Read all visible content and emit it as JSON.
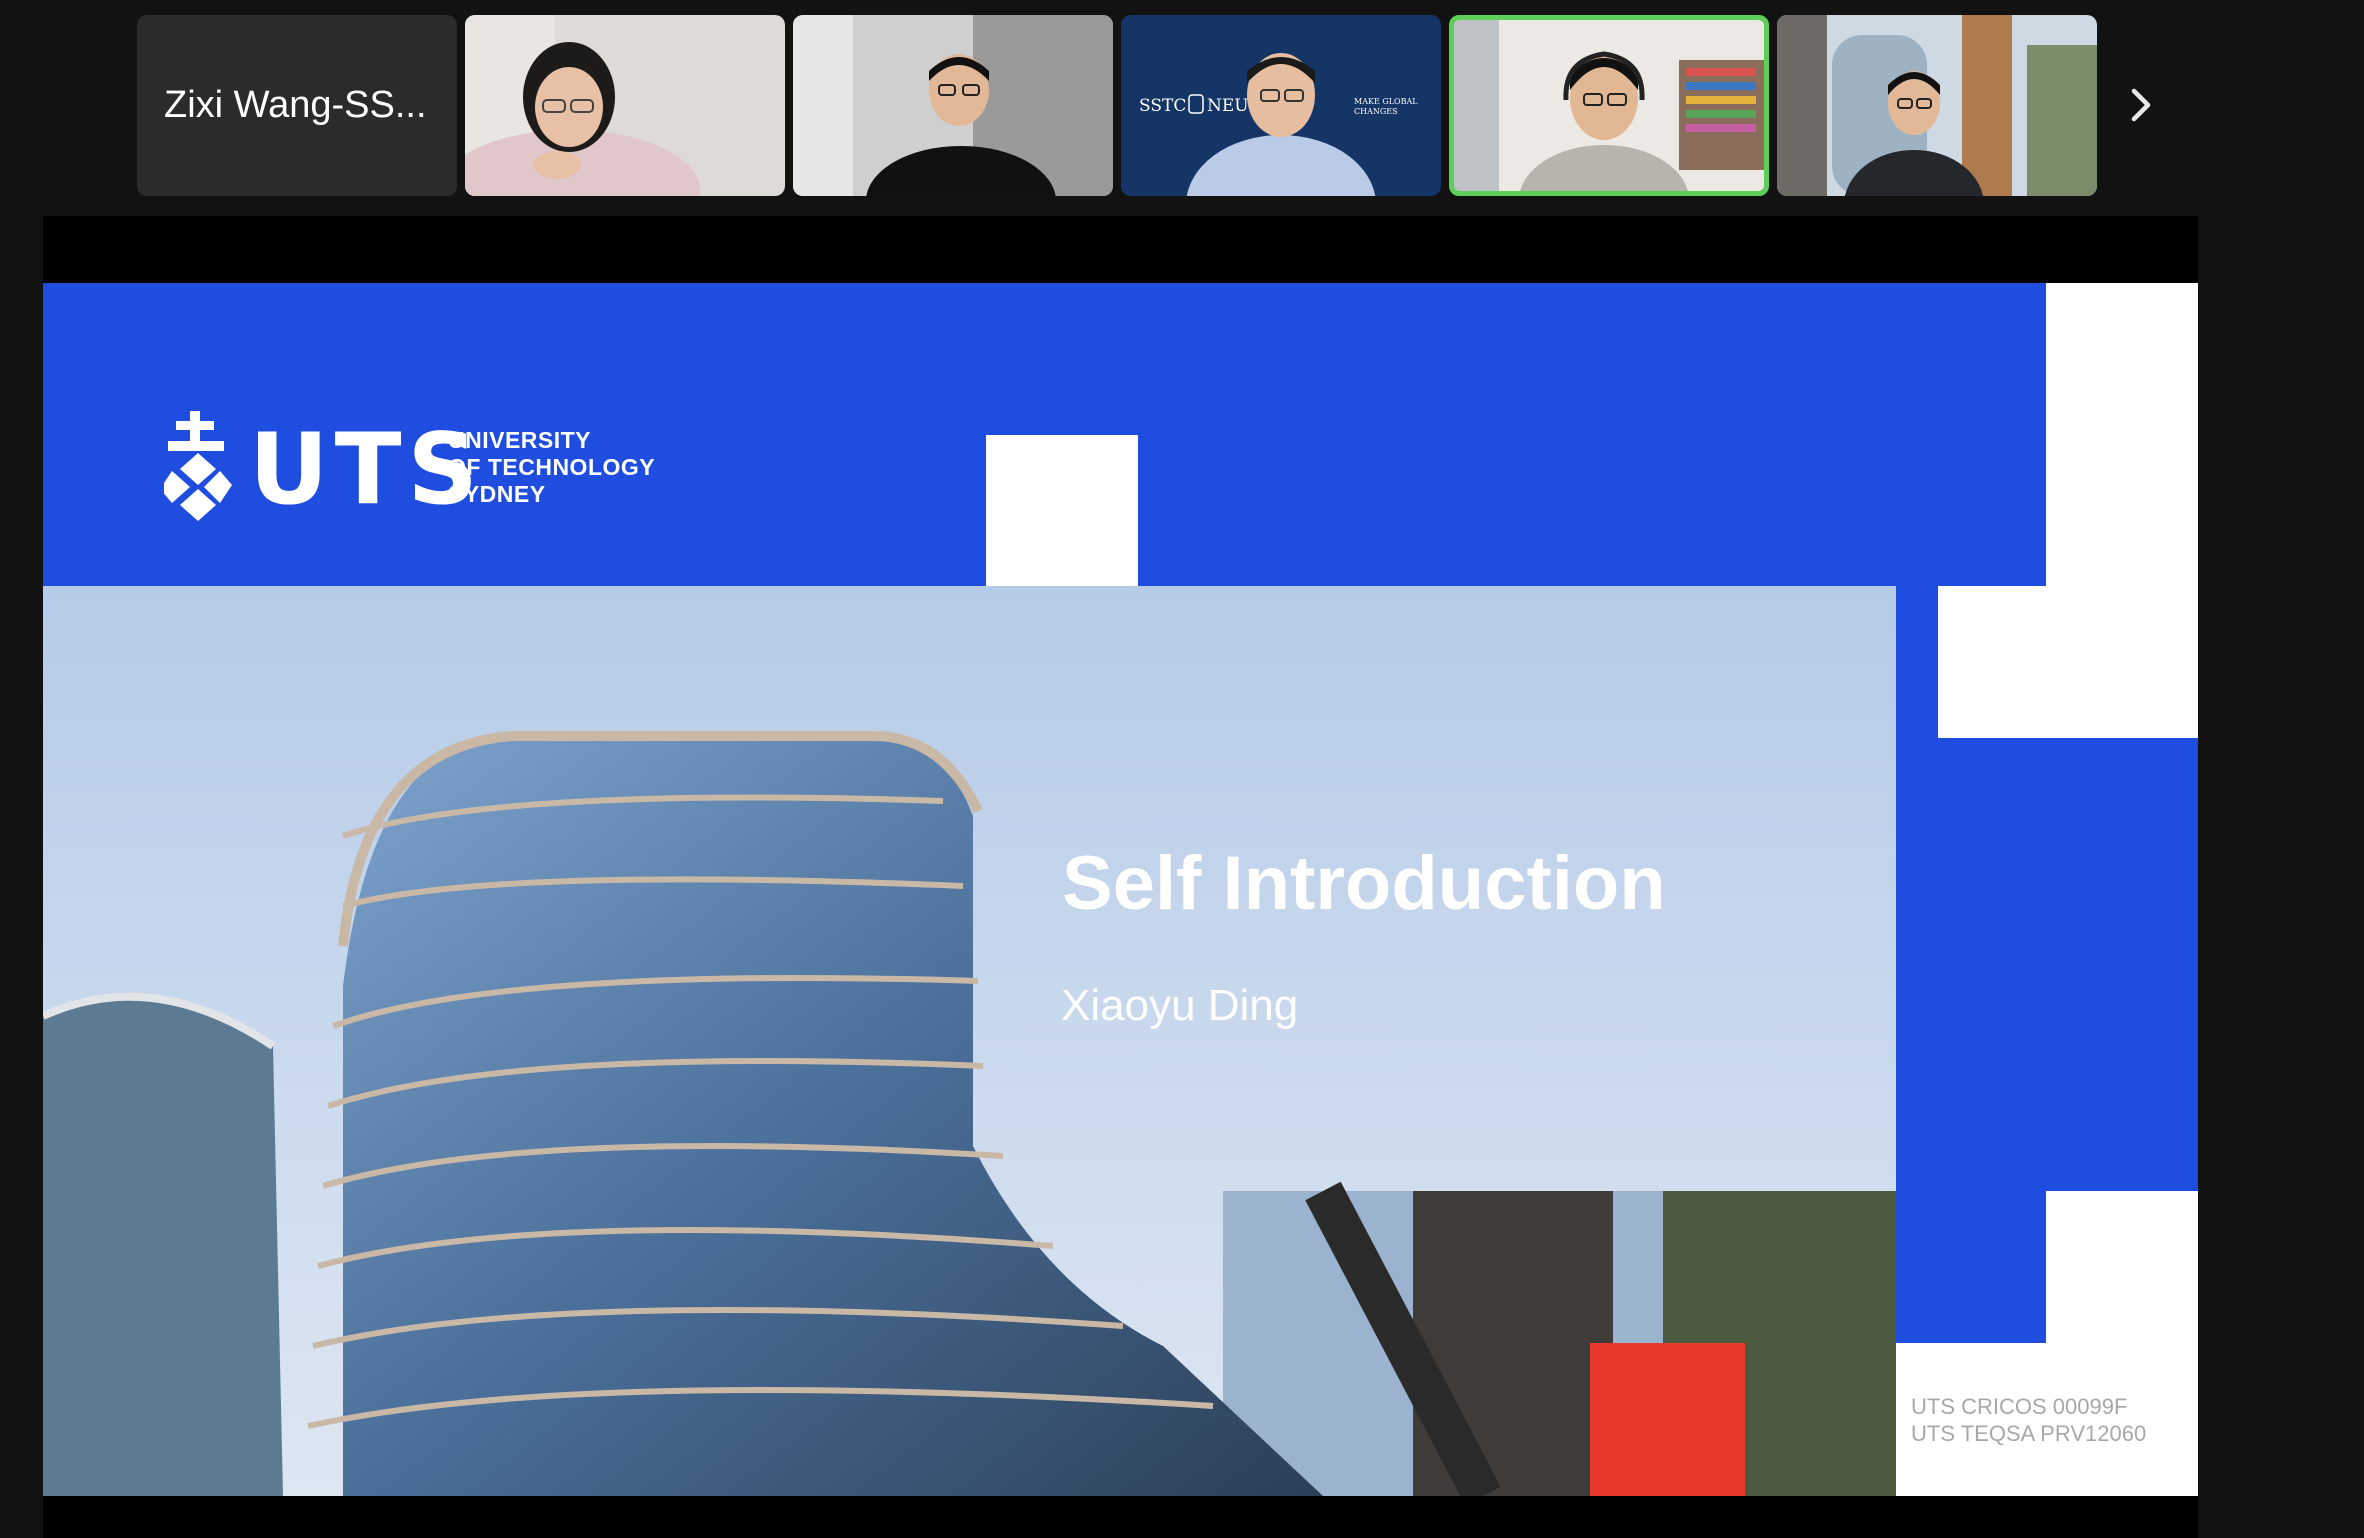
{
  "participants": [
    {
      "name": "Zixi Wang-SS...",
      "video": false
    },
    {
      "video": true
    },
    {
      "video": true
    },
    {
      "video": true,
      "background_text": [
        "SSTC",
        "NEU",
        "MAKE GLOBAL",
        "CHANGES"
      ]
    },
    {
      "video": true,
      "active_speaker": true
    },
    {
      "video": true
    }
  ],
  "strip": {
    "next_icon": "chevron-right-icon"
  },
  "slide": {
    "logo": {
      "wordmark": "UTS",
      "line1": "UNIVERSITY",
      "line2": "OF TECHNOLOGY",
      "line3": "SYDNEY"
    },
    "title": "Self Introduction",
    "presenter": "Xiaoyu Ding",
    "legal_line1": "UTS CRICOS 00099F",
    "legal_line2": "UTS TEQSA PRV12060"
  },
  "colors": {
    "slide_blue": "#1f4de0",
    "accent_red": "#e8392a",
    "active_speaker_border": "#5ed05a",
    "app_background": "#121212"
  }
}
